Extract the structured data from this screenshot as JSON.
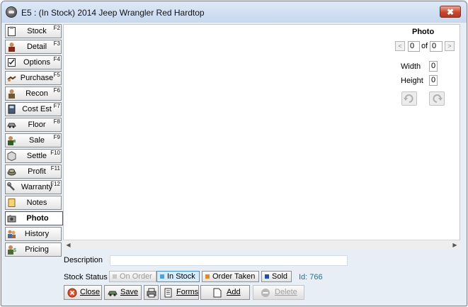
{
  "window": {
    "title": "E5 : (In Stock) 2014 Jeep Wrangler  Red Hardtop",
    "close_label": "✖"
  },
  "sidebar": {
    "items": [
      {
        "label": "Stock",
        "key": "F2",
        "icon": "clipboard-icon",
        "active": false
      },
      {
        "label": "Detail",
        "key": "F3",
        "icon": "person-icon",
        "active": false
      },
      {
        "label": "Options",
        "key": "F4",
        "icon": "checklist-icon",
        "active": false
      },
      {
        "label": "Purchase",
        "key": "F5",
        "icon": "handshake-icon",
        "active": false
      },
      {
        "label": "Recon",
        "key": "F6",
        "icon": "mechanic-icon",
        "active": false
      },
      {
        "label": "Cost Est",
        "key": "F7",
        "icon": "calculator-icon",
        "active": false
      },
      {
        "label": "Floor",
        "key": "F8",
        "icon": "car-icon",
        "active": false
      },
      {
        "label": "Sale",
        "key": "F9",
        "icon": "salesperson-icon",
        "active": false
      },
      {
        "label": "Settle",
        "key": "F10",
        "icon": "box-icon",
        "active": false
      },
      {
        "label": "Profit",
        "key": "F11",
        "icon": "money-icon",
        "active": false
      },
      {
        "label": "Warranty",
        "key": "F12",
        "icon": "wrench-icon",
        "active": false
      },
      {
        "label": "Notes",
        "key": "",
        "icon": "notepad-icon",
        "active": false
      },
      {
        "label": "Photo",
        "key": "",
        "icon": "camera-icon",
        "active": true
      },
      {
        "label": "History",
        "key": "",
        "icon": "people-icon",
        "active": false
      },
      {
        "label": "Pricing",
        "key": "",
        "icon": "price-person-icon",
        "active": false
      }
    ]
  },
  "photo": {
    "title": "Photo",
    "prev_label": "<",
    "next_label": ">",
    "current": "0",
    "of_label": "of",
    "total": "0",
    "width_label": "Width",
    "width_value": "0",
    "height_label": "Height",
    "height_value": "0"
  },
  "scroll": {
    "left_arrow": "◀",
    "right_arrow": "▶"
  },
  "description": {
    "label": "Description",
    "value": ""
  },
  "stock_status": {
    "label": "Stock Status",
    "options": [
      {
        "label": "On Order",
        "state": "disabled",
        "color": "#bdbdbd"
      },
      {
        "label": "In Stock",
        "state": "active",
        "color": "#4aa3df"
      },
      {
        "label": "Order Taken",
        "state": "normal",
        "color": "#e08a2e"
      },
      {
        "label": "Sold",
        "state": "normal",
        "color": "#1f4fa8"
      }
    ],
    "id_text": "Id: 766"
  },
  "actions": {
    "close_label": "Close",
    "save_label": "Save",
    "forms_label": "Forms",
    "add_label": "Add",
    "delete_label": "Delete"
  }
}
